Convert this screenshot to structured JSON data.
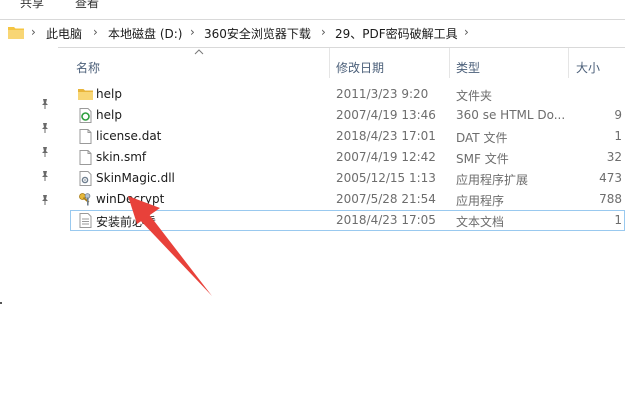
{
  "ribbon": {
    "tabs": [
      "共享",
      "查看"
    ]
  },
  "address": {
    "crumbs": [
      "此电脑",
      "本地磁盘 (D:)",
      "360安全浏览器下载",
      "29、PDF密码破解工具"
    ]
  },
  "columns": {
    "name": "名称",
    "date": "修改日期",
    "type": "类型",
    "size": "大小"
  },
  "files": [
    {
      "name": "help",
      "date": "2011/3/23 9:20",
      "type": "文件夹",
      "size": "",
      "icon": "folder-icon"
    },
    {
      "name": "help",
      "date": "2007/4/19 13:46",
      "type": "360 se HTML Do...",
      "size": "9",
      "icon": "html-file-icon"
    },
    {
      "name": "license.dat",
      "date": "2018/4/23 17:01",
      "type": "DAT 文件",
      "size": "1",
      "icon": "blank-file-icon"
    },
    {
      "name": "skin.smf",
      "date": "2007/4/19 12:42",
      "type": "SMF 文件",
      "size": "32",
      "icon": "blank-file-icon"
    },
    {
      "name": "SkinMagic.dll",
      "date": "2005/12/15 1:13",
      "type": "应用程序扩展",
      "size": "473",
      "icon": "dll-file-icon"
    },
    {
      "name": "winDecrypt",
      "date": "2007/5/28 21:54",
      "type": "应用程序",
      "size": "788",
      "icon": "keys-app-icon"
    },
    {
      "name": "安装前必看",
      "date": "2018/4/23 17:05",
      "type": "文本文档",
      "size": "1",
      "icon": "text-file-icon"
    }
  ],
  "colors": {
    "annotation_arrow": "#e8413a",
    "selection_border": "#99c9ef",
    "folder": "#f5c542"
  }
}
